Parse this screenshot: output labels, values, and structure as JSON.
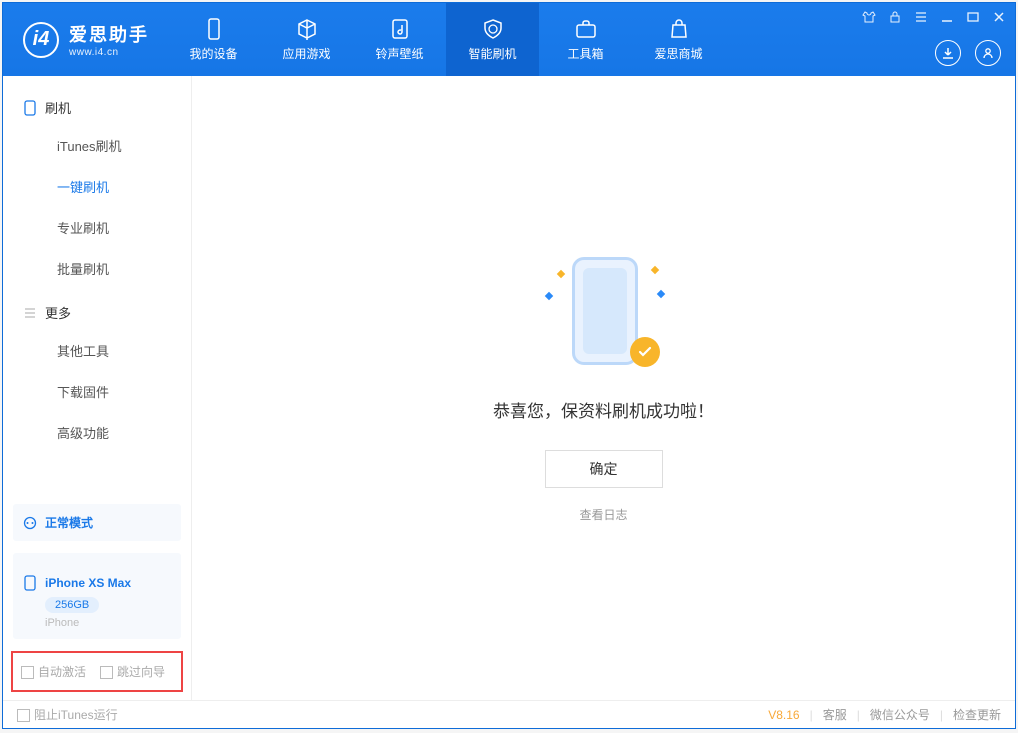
{
  "app": {
    "name": "爱思助手",
    "url": "www.i4.cn"
  },
  "tabs": [
    {
      "label": "我的设备"
    },
    {
      "label": "应用游戏"
    },
    {
      "label": "铃声壁纸"
    },
    {
      "label": "智能刷机"
    },
    {
      "label": "工具箱"
    },
    {
      "label": "爱思商城"
    }
  ],
  "sidebar": {
    "group1": {
      "title": "刷机",
      "items": [
        "iTunes刷机",
        "一键刷机",
        "专业刷机",
        "批量刷机"
      ]
    },
    "group2": {
      "title": "更多",
      "items": [
        "其他工具",
        "下载固件",
        "高级功能"
      ]
    }
  },
  "device": {
    "mode": "正常模式",
    "name": "iPhone XS Max",
    "capacity": "256GB",
    "type": "iPhone"
  },
  "bottom_opts": {
    "opt1": "自动激活",
    "opt2": "跳过向导"
  },
  "main": {
    "success": "恭喜您，保资料刷机成功啦！",
    "ok": "确定",
    "viewlog": "查看日志"
  },
  "statusbar": {
    "block_itunes": "阻止iTunes运行",
    "version": "V8.16",
    "support": "客服",
    "wechat": "微信公众号",
    "update": "检查更新"
  }
}
